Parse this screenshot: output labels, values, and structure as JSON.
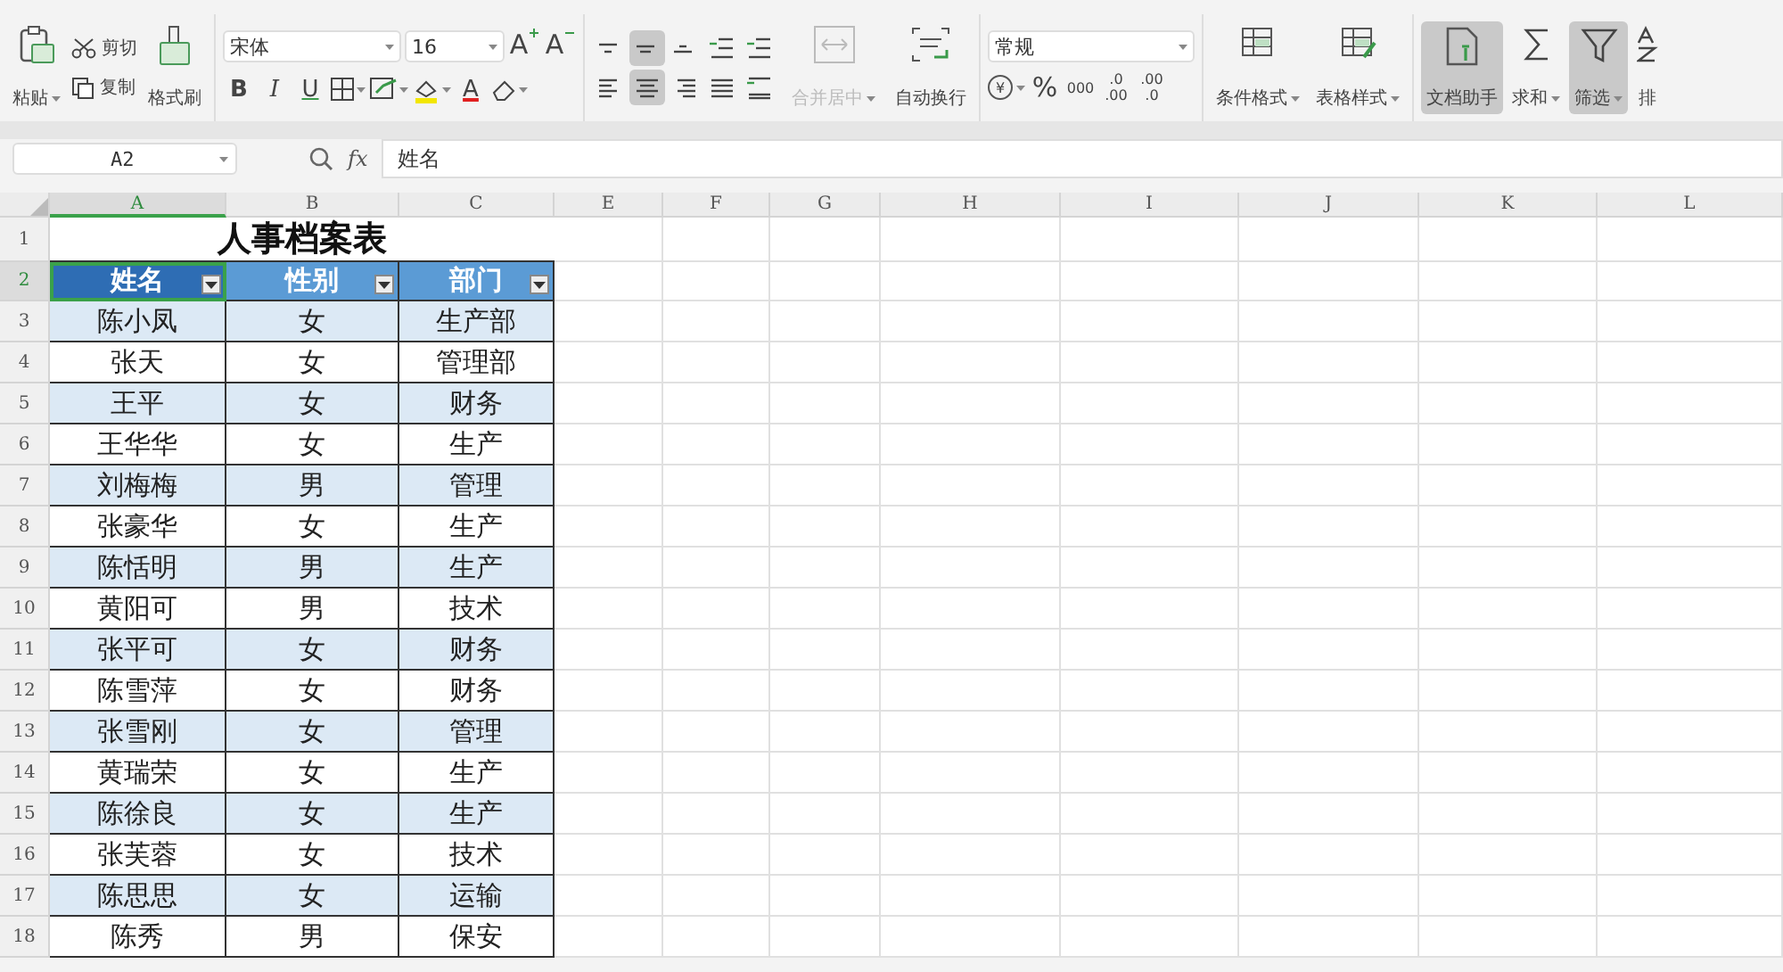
{
  "ribbon": {
    "clipboard": {
      "paste": "粘贴",
      "cut": "剪切",
      "copy": "复制",
      "format_painter": "格式刷"
    },
    "font": {
      "name": "宋体",
      "size": "16",
      "grow": "A",
      "shrink": "A",
      "bold": "B",
      "italic": "I",
      "underline": "U",
      "font_color": "A"
    },
    "alignment": [
      {
        "kind": "top",
        "selected": false
      },
      {
        "kind": "middle",
        "selected": true
      },
      {
        "kind": "bottom",
        "selected": false
      },
      {
        "kind": "outdent",
        "selected": false
      },
      {
        "kind": "indent",
        "selected": false
      },
      {
        "kind": "left",
        "selected": false
      },
      {
        "kind": "center",
        "selected": true
      },
      {
        "kind": "right",
        "selected": false
      },
      {
        "kind": "justify",
        "selected": false
      },
      {
        "kind": "distribute",
        "selected": false
      }
    ],
    "merge": {
      "label": "合并居中",
      "disabled": true
    },
    "wrap": {
      "label": "自动换行",
      "disabled": false
    },
    "number": {
      "format": "常规",
      "currency": "¥",
      "percent": "%",
      "thousands": "000",
      "inc_decimal": [
        ".0",
        ".00"
      ],
      "dec_decimal": [
        ".00",
        ".0"
      ]
    },
    "styles": [
      "条件格式",
      "表格样式"
    ],
    "tools": [
      {
        "kind": "assistant",
        "label": "文档助手",
        "selected": true
      },
      {
        "kind": "sum",
        "label": "求和",
        "selected": false
      },
      {
        "kind": "filter",
        "label": "筛选",
        "selected": true
      },
      {
        "kind": "sort",
        "label": "排",
        "selected": false
      }
    ]
  },
  "formula_bar": {
    "name_box": "A2",
    "fx": "fx",
    "value": "姓名"
  },
  "sheet": {
    "columns": [
      {
        "label": "A",
        "selected": true
      },
      {
        "label": "B",
        "selected": false
      },
      {
        "label": "C",
        "selected": false
      },
      {
        "label": "E",
        "selected": false
      },
      {
        "label": "F",
        "selected": false
      },
      {
        "label": "G",
        "selected": false
      },
      {
        "label": "H",
        "selected": false
      },
      {
        "label": "I",
        "selected": false
      },
      {
        "label": "J",
        "selected": false
      },
      {
        "label": "K",
        "selected": false
      },
      {
        "label": "L",
        "selected": false
      }
    ],
    "title": {
      "number": "1",
      "text": "人事档案表"
    },
    "header": {
      "number": "2",
      "selected": true,
      "cells": [
        "姓名",
        "性别",
        "部门"
      ]
    },
    "rows": [
      {
        "number": "3",
        "cells": [
          "陈小凤",
          "女",
          "生产部"
        ]
      },
      {
        "number": "4",
        "cells": [
          "张天",
          "女",
          "管理部"
        ]
      },
      {
        "number": "5",
        "cells": [
          "王平",
          "女",
          "财务"
        ]
      },
      {
        "number": "6",
        "cells": [
          "王华华",
          "女",
          "生产"
        ]
      },
      {
        "number": "7",
        "cells": [
          "刘梅梅",
          "男",
          "管理"
        ]
      },
      {
        "number": "8",
        "cells": [
          "张豪华",
          "女",
          "生产"
        ]
      },
      {
        "number": "9",
        "cells": [
          "陈恬明",
          "男",
          "生产"
        ]
      },
      {
        "number": "10",
        "cells": [
          "黄阳可",
          "男",
          "技术"
        ]
      },
      {
        "number": "11",
        "cells": [
          "张平可",
          "女",
          "财务"
        ]
      },
      {
        "number": "12",
        "cells": [
          "陈雪萍",
          "女",
          "财务"
        ]
      },
      {
        "number": "13",
        "cells": [
          "张雪刚",
          "女",
          "管理"
        ]
      },
      {
        "number": "14",
        "cells": [
          "黄瑞荣",
          "女",
          "生产"
        ]
      },
      {
        "number": "15",
        "cells": [
          "陈徐良",
          "女",
          "生产"
        ]
      },
      {
        "number": "16",
        "cells": [
          "张芙蓉",
          "女",
          "技术"
        ]
      },
      {
        "number": "17",
        "cells": [
          "陈思思",
          "女",
          "运输"
        ]
      },
      {
        "number": "18",
        "cells": [
          "陈秀",
          "男",
          "保安"
        ]
      }
    ]
  }
}
